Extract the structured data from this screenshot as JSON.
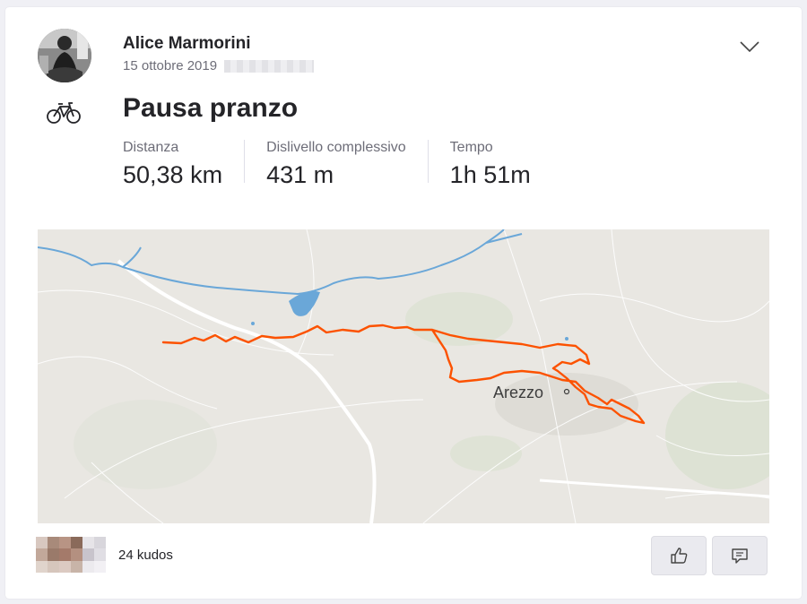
{
  "athlete": {
    "name": "Alice Marmorini",
    "date": "15 ottobre 2019"
  },
  "activity": {
    "sport": "bicycle-icon",
    "title": "Pausa pranzo",
    "stats": [
      {
        "label": "Distanza",
        "value": "50,38 km"
      },
      {
        "label": "Dislivello complessivo",
        "value": "431 m"
      },
      {
        "label": "Tempo",
        "value": "1h 51m"
      }
    ]
  },
  "map": {
    "city_label": "Arezzo",
    "route_color": "#fc5200",
    "water_color": "#6aa7d8"
  },
  "kudos": {
    "count_label": "24 kudos"
  },
  "icons": {
    "menu": "chevron-down-icon",
    "kudos_button": "thumbs-up-icon",
    "comment_button": "comment-icon"
  },
  "colors": {
    "accent": "#fc5200",
    "text": "#242428",
    "muted": "#6d6d78"
  }
}
